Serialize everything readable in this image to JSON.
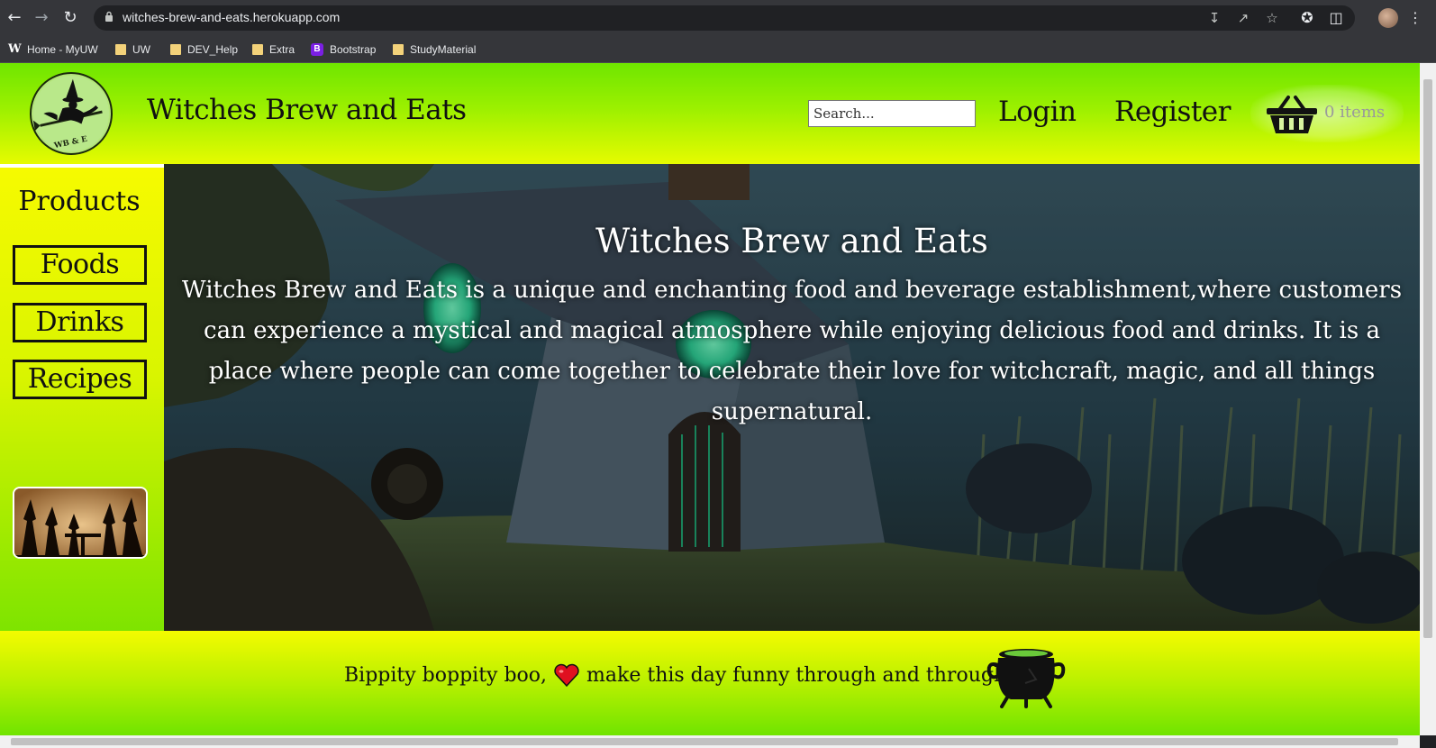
{
  "browser": {
    "url": "witches-brew-and-eats.herokuapp.com",
    "bookmarks": [
      {
        "label": "Home - MyUW",
        "icon": "uw-w-icon"
      },
      {
        "label": "UW",
        "icon": "folder-icon"
      },
      {
        "label": "DEV_Help",
        "icon": "folder-icon"
      },
      {
        "label": "Extra",
        "icon": "folder-icon"
      },
      {
        "label": "Bootstrap",
        "icon": "bootstrap-icon"
      },
      {
        "label": "StudyMaterial",
        "icon": "folder-icon"
      }
    ]
  },
  "header": {
    "logo_text": "WB & E",
    "title": "Witches Brew and Eats",
    "search_placeholder": "Search...",
    "login": "Login",
    "register": "Register",
    "cart_count": "0 items"
  },
  "sidebar": {
    "heading": "Products",
    "items": [
      "Foods",
      "Drinks",
      "Recipes"
    ]
  },
  "hero": {
    "title": "Witches Brew and Eats",
    "description": "Witches Brew and Eats is a unique and enchanting food and beverage establishment,where customers can experience a mystical and magical atmosphere while enjoying delicious food and drinks. It is a place where people can come together to celebrate their love for witchcraft, magic, and all things supernatural."
  },
  "footer": {
    "text_before": "Bippity boppity boo,",
    "text_after": "make this day funny through and through!"
  },
  "colors": {
    "header_green": "#9cf000",
    "header_yellow": "#e6fb00",
    "hero_teal": "#263b46",
    "window_glow": "#4dffb0"
  }
}
